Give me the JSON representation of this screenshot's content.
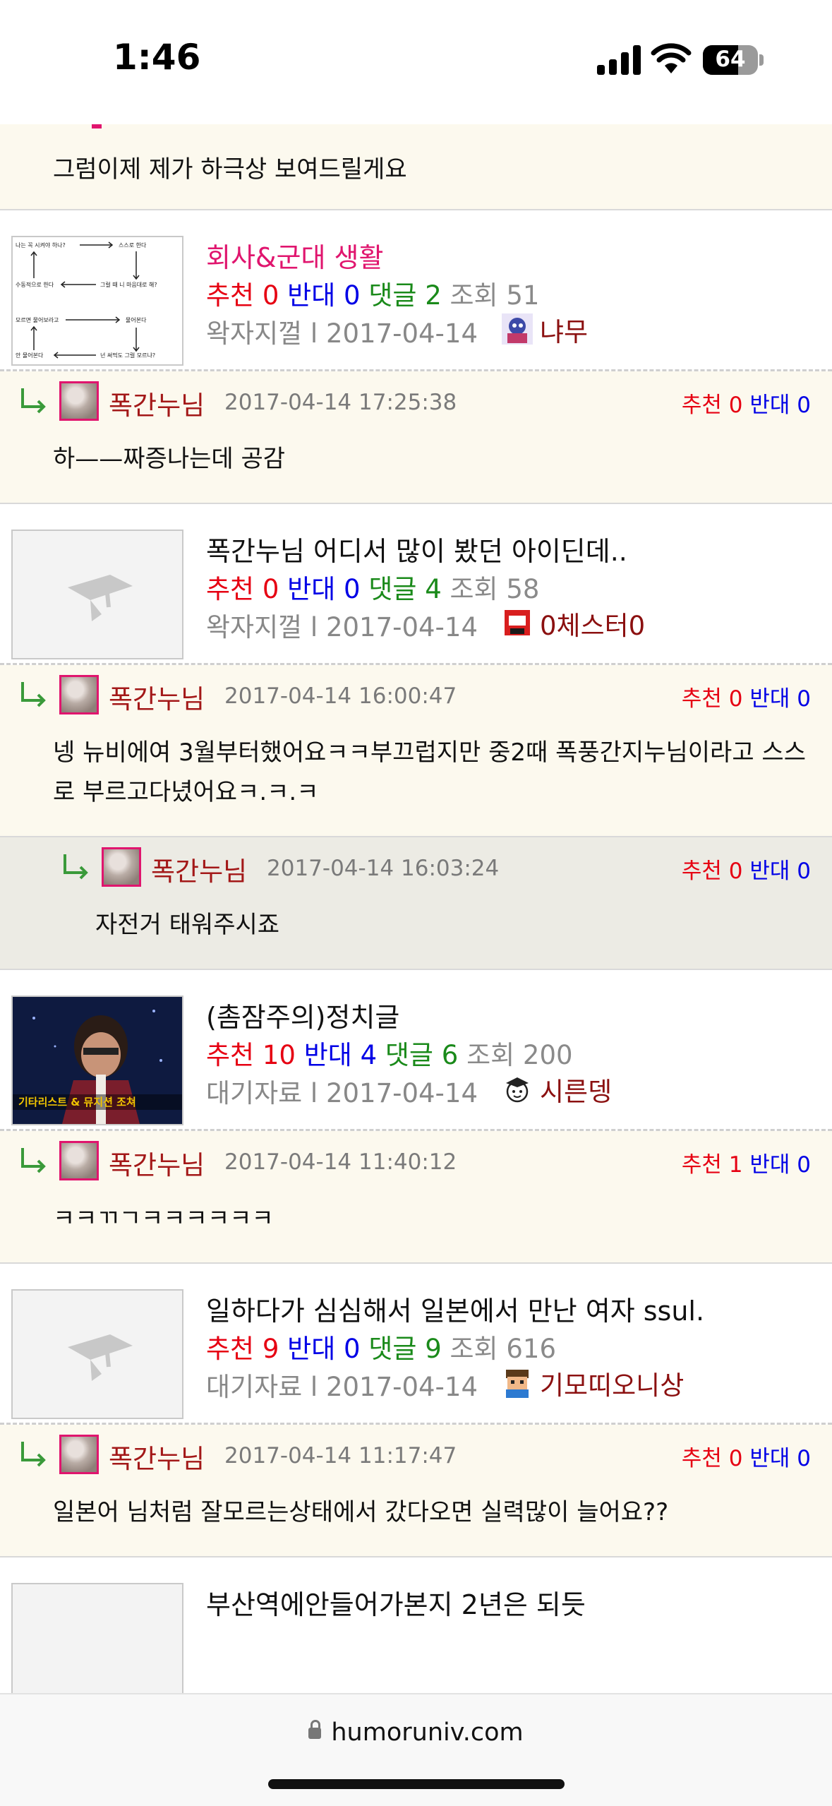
{
  "status_bar": {
    "time": "1:46",
    "battery": "64",
    "battery_level": 0.64
  },
  "top_comment": {
    "text": "그럼이제 제가 하극상 보여드릴게요"
  },
  "label_recommend": "추천",
  "label_oppose": "반대",
  "label_comments": "댓글",
  "label_views": "조회",
  "posts": [
    {
      "title": "회사&군대 생활",
      "recommend": "0",
      "oppose": "0",
      "comments": "2",
      "views": "51",
      "meta": "왁자지껄 l 2017-04-14",
      "author": "냐무",
      "thumb": "flow-diagram",
      "thumb_text": [
        "나는 꼭 시켜야 하나?",
        "스스로 한다",
        "수동적으로 한다",
        "그럴 때 니 마음대로 해?",
        "모르면 물어보라고",
        "물어본다",
        "안 물어본다",
        "넌 써먹도 그럴 모르냐?"
      ],
      "comment": {
        "author": "폭간누님",
        "date": "2017-04-14 17:25:38",
        "recommend": "0",
        "oppose": "0",
        "text": "하——짜증나는데 공감"
      }
    },
    {
      "title": "폭간누님 어디서 많이 봤던 아이딘데..",
      "recommend": "0",
      "oppose": "0",
      "comments": "4",
      "views": "58",
      "meta": "왁자지껄 l 2017-04-14",
      "author": "0체스터0",
      "thumb": "placeholder",
      "comment": {
        "author": "폭간누님",
        "date": "2017-04-14 16:00:47",
        "recommend": "0",
        "oppose": "0",
        "text": "넹 뉴비에여 3월부터했어요ㅋㅋ부끄럽지만 중2때 폭풍간지누님이라고 스스로 부르고다녔어요ㅋ.ㅋ.ㅋ"
      },
      "reply": {
        "author": "폭간누님",
        "date": "2017-04-14 16:03:24",
        "recommend": "0",
        "oppose": "0",
        "text": "자전거 태워주시죠"
      }
    },
    {
      "title": "(촘잠주의)정치글",
      "recommend": "10",
      "oppose": "4",
      "comments": "6",
      "views": "200",
      "meta": "대기자료 l 2017-04-14",
      "author": "시른뎅",
      "thumb": "photo",
      "thumb_caption": "기타리스트 & 뮤지션 조쳐",
      "comment": {
        "author": "폭간누님",
        "date": "2017-04-14 11:40:12",
        "recommend": "1",
        "oppose": "0",
        "text": "ㅋㅋㄲㄱㅋㅋㅋㅋㅋㅋ"
      }
    },
    {
      "title": "일하다가 심심해서 일본에서 만난 여자 ssul.",
      "recommend": "9",
      "oppose": "0",
      "comments": "9",
      "views": "616",
      "meta": "대기자료 l 2017-04-14",
      "author": "기모띠오니상",
      "thumb": "placeholder",
      "comment": {
        "author": "폭간누님",
        "date": "2017-04-14 11:17:47",
        "recommend": "0",
        "oppose": "0",
        "text": "일본어 님처럼 잘모르는상태에서 갔다오면 실력많이 늘어요??"
      }
    },
    {
      "title": "부산역에안들어가본지 2년은 되듯",
      "thumb": "placeholder"
    }
  ],
  "url_bar": {
    "domain": "humoruniv.com"
  },
  "colors": {
    "recommend": "#e60012",
    "oppose": "#0000e6",
    "comments": "#1a8a1a",
    "author": "#a31818",
    "pink_title": "#e0156e",
    "comment_bg": "#fcf9ee"
  }
}
